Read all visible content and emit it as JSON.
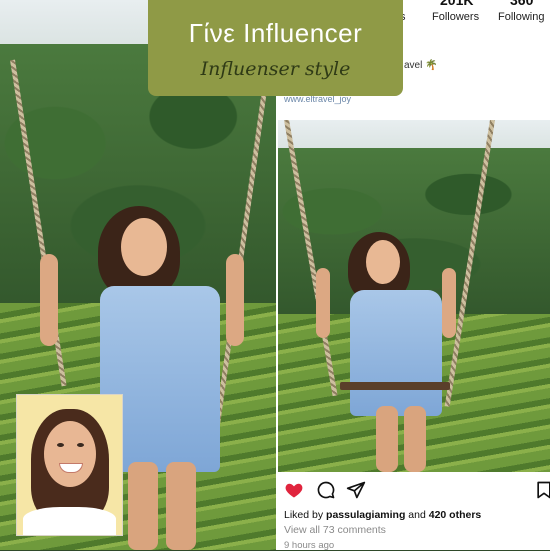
{
  "banner": {
    "title": "Γίνε Influencer",
    "subtitle": "Influenser style"
  },
  "profile": {
    "followers_count": "201K",
    "followers_label": "Followers",
    "following_count": "360",
    "following_label": "Following",
    "stat_left_label_fragment": "s",
    "bio_fragment": "avel 🌴",
    "link_text": "www.eltravel_joy"
  },
  "post": {
    "liked_prefix": "Liked by ",
    "liked_user": "passulagiaming",
    "liked_middle": " and ",
    "liked_others": "420 others",
    "view_comments": "View all 73 comments",
    "time_ago": "9 hours ago"
  },
  "icons": {
    "like": "heart-icon",
    "comment": "comment-icon",
    "share": "send-icon",
    "save": "bookmark-icon"
  },
  "colors": {
    "banner_bg": "#8f9a46",
    "heart": "#e0243d",
    "link": "#6a86a8"
  }
}
